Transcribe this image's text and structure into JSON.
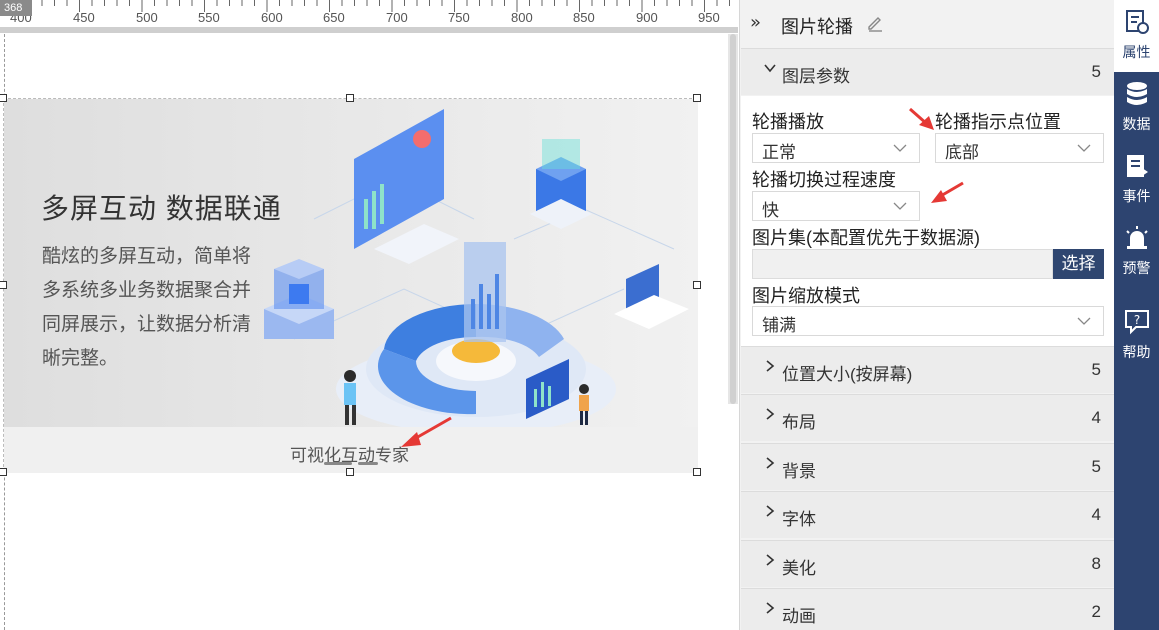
{
  "ruler": {
    "corner": "368",
    "ticks": [
      "400",
      "450",
      "500",
      "550",
      "600",
      "650",
      "700",
      "750",
      "800",
      "850",
      "900",
      "950"
    ]
  },
  "carousel": {
    "title": "多屏互动  数据联通",
    "description": "酷炫的多屏互动，简单将多系统多业务数据聚合并同屏展示，让数据分析清晰完整。",
    "caption": "可视化互动专家"
  },
  "panel": {
    "title": "图片轮播",
    "layer_section": {
      "label": "图层参数",
      "count": "5"
    },
    "fields": {
      "autoplay_label": "轮播播放",
      "autoplay_value": "正常",
      "dot_position_label": "轮播指示点位置",
      "dot_position_value": "底部",
      "speed_label": "轮播切换过程速度",
      "speed_value": "快",
      "image_set_label": "图片集(本配置优先于数据源)",
      "choose_button": "选择",
      "scale_label": "图片缩放模式",
      "scale_value": "铺满"
    },
    "sections": [
      {
        "label": "位置大小(按屏幕)",
        "count": "5"
      },
      {
        "label": "布局",
        "count": "4"
      },
      {
        "label": "背景",
        "count": "5"
      },
      {
        "label": "字体",
        "count": "4"
      },
      {
        "label": "美化",
        "count": "8"
      },
      {
        "label": "动画",
        "count": "2"
      }
    ]
  },
  "toolbar": {
    "items": [
      {
        "label": "属性",
        "icon": "properties-icon"
      },
      {
        "label": "数据",
        "icon": "database-icon"
      },
      {
        "label": "事件",
        "icon": "event-icon"
      },
      {
        "label": "预警",
        "icon": "alarm-icon"
      },
      {
        "label": "帮助",
        "icon": "help-icon"
      }
    ]
  },
  "colors": {
    "toolbar_bg": "#2d4470",
    "choose_button_bg": "#2f4670",
    "annotation_arrow": "#e53935"
  }
}
